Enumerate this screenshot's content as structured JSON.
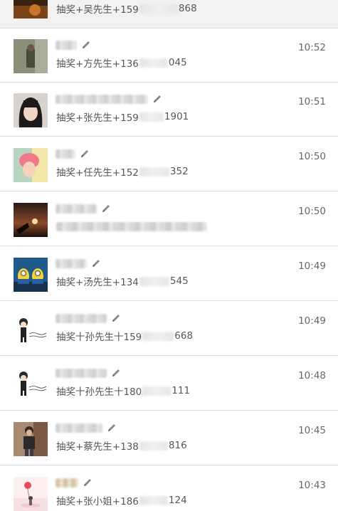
{
  "messages": [
    {
      "msg_pre": "抽奖+吴先生+159",
      "msg_post": "868",
      "time": ""
    },
    {
      "msg_pre": "抽奖+方先生+136",
      "msg_post": "045",
      "time": "10:52"
    },
    {
      "msg_pre": "抽奖+张先生+159",
      "msg_post": "1901",
      "time": "10:51"
    },
    {
      "msg_pre": "抽奖+任先生+152",
      "msg_post": "352",
      "time": "10:50"
    },
    {
      "msg_pre": "",
      "msg_post": "",
      "time": "10:50"
    },
    {
      "msg_pre": "抽奖+汤先生+134",
      "msg_post": "545",
      "time": "10:49"
    },
    {
      "msg_pre": "抽奖十孙先生十159",
      "msg_post": "668",
      "time": "10:49"
    },
    {
      "msg_pre": "抽奖十孙先生十180",
      "msg_post": "111",
      "time": "10:48"
    },
    {
      "msg_pre": "抽奖+蔡先生+138",
      "msg_post": "816",
      "time": "10:45"
    },
    {
      "msg_pre": "抽奖+张小姐+186",
      "msg_post": "124",
      "time": "10:43"
    }
  ],
  "icons": {
    "edit": "pencil-icon",
    "avatar": "avatar"
  },
  "colors": {
    "text": "#555555",
    "time": "#666666",
    "divider": "#dcdcdc",
    "pencil": "#888888"
  }
}
